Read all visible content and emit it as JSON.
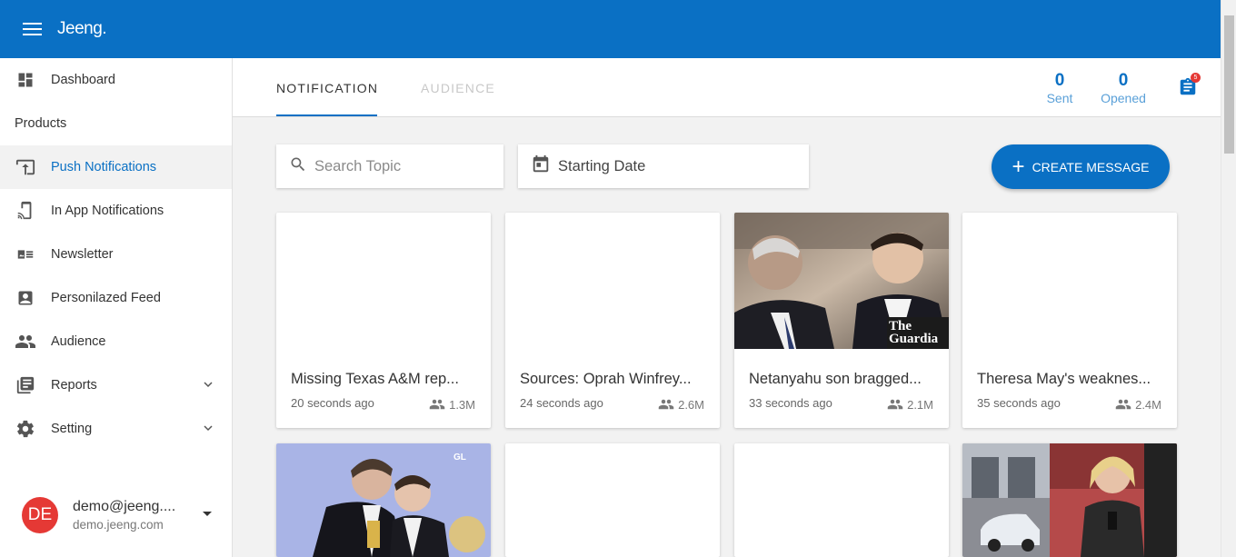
{
  "app": {
    "logo": "Jeeng."
  },
  "sidebar": {
    "items": [
      {
        "label": "Dashboard",
        "icon": "dashboard-icon"
      },
      {
        "section": "Products"
      },
      {
        "label": "Push Notifications",
        "icon": "push-notification-icon",
        "active": true
      },
      {
        "label": "In App Notifications",
        "icon": "cast-icon"
      },
      {
        "label": "Newsletter",
        "icon": "newsletter-icon"
      },
      {
        "label": "Personilazed Feed",
        "icon": "person-feed-icon"
      },
      {
        "label": "Audience",
        "icon": "people-icon"
      },
      {
        "label": "Reports",
        "icon": "reports-icon",
        "expandable": true
      },
      {
        "label": "Setting",
        "icon": "gear-icon",
        "expandable": true
      }
    ],
    "user": {
      "initials": "DE",
      "email": "demo@jeeng.com",
      "email_display": "demo@jeeng....",
      "domain": "demo.jeeng.com"
    }
  },
  "tabs": [
    {
      "label": "NOTIFICATION",
      "active": true
    },
    {
      "label": "AUDIENCE",
      "active": false
    }
  ],
  "stats": {
    "sent": {
      "value": "0",
      "label": "Sent"
    },
    "opened": {
      "value": "0",
      "label": "Opened"
    },
    "clipboard_badge": "5"
  },
  "controls": {
    "search_placeholder": "Search Topic",
    "date_label": "Starting Date",
    "create_label": "CREATE MESSAGE"
  },
  "cards": [
    {
      "title": "Missing Texas A&M rep...",
      "time": "20 seconds ago",
      "audience": "1.3M",
      "image": "blank"
    },
    {
      "title": "Sources: Oprah Winfrey...",
      "time": "24 seconds ago",
      "audience": "2.6M",
      "image": "blank"
    },
    {
      "title": "Netanyahu son bragged...",
      "time": "33 seconds ago",
      "audience": "2.1M",
      "image": "photo",
      "watermark": "The Guardia"
    },
    {
      "title": "Theresa May's weaknes...",
      "time": "35 seconds ago",
      "audience": "2.4M",
      "image": "blank"
    },
    {
      "title": "",
      "time": "",
      "audience": "",
      "image": "photo"
    },
    {
      "title": "",
      "time": "",
      "audience": "",
      "image": "blank"
    },
    {
      "title": "",
      "time": "",
      "audience": "",
      "image": "blank"
    },
    {
      "title": "",
      "time": "",
      "audience": "",
      "image": "photo"
    }
  ],
  "colors": {
    "brand": "#0a70c4",
    "avatar": "#e53935",
    "badge": "#e53935"
  }
}
